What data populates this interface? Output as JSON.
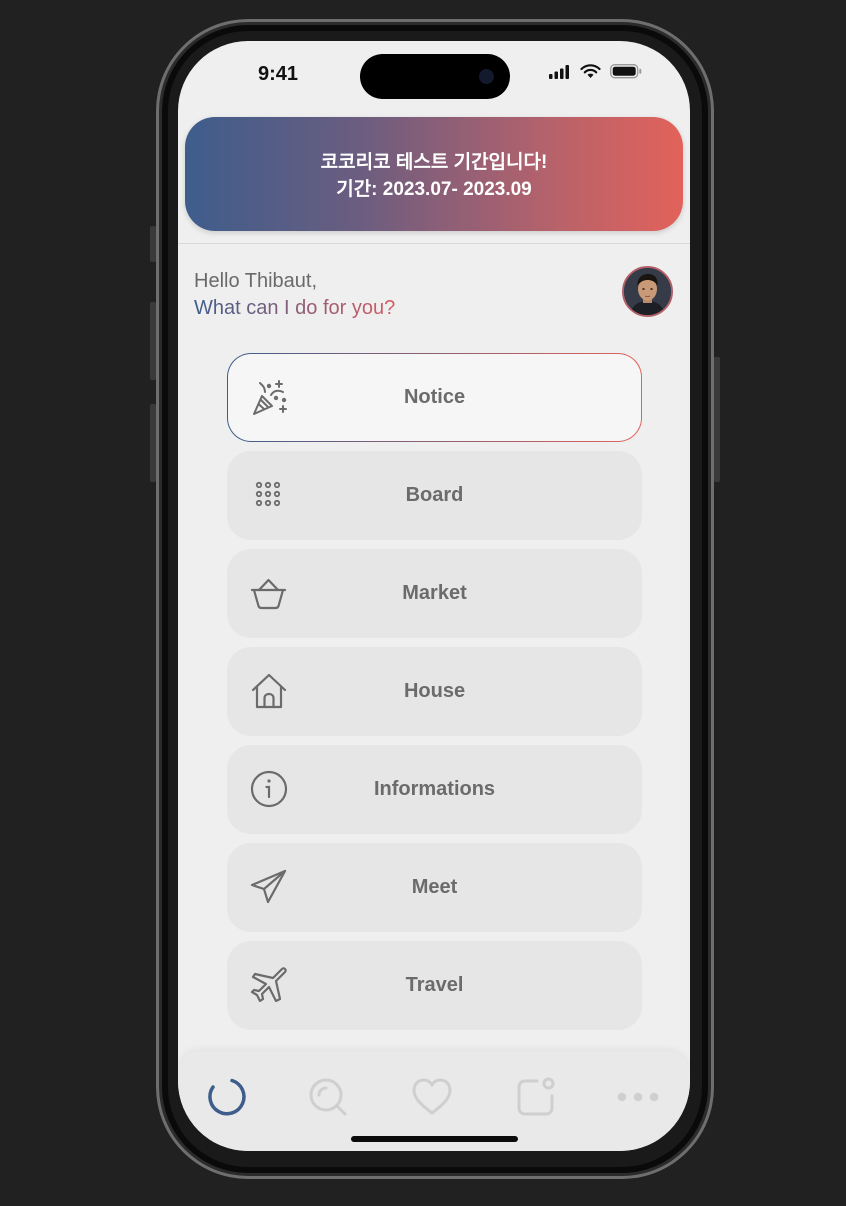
{
  "status_bar": {
    "time": "9:41"
  },
  "banner": {
    "title": "코코리코 테스트 기간입니다!",
    "period": "기간: 2023.07- 2023.09"
  },
  "greeting": {
    "hello": "Hello Thibaut,",
    "question": "What can I do for you?"
  },
  "menu": {
    "items": [
      {
        "label": "Notice",
        "icon": "party-popper-icon",
        "active": true
      },
      {
        "label": "Board",
        "icon": "grid-dots-icon"
      },
      {
        "label": "Market",
        "icon": "basket-icon"
      },
      {
        "label": "House",
        "icon": "house-icon"
      },
      {
        "label": "Informations",
        "icon": "info-icon"
      },
      {
        "label": "Meet",
        "icon": "paper-plane-icon"
      },
      {
        "label": "Travel",
        "icon": "airplane-icon"
      }
    ]
  },
  "tab_bar": {
    "tabs": [
      {
        "icon": "spinner-icon",
        "active": true
      },
      {
        "icon": "search-icon"
      },
      {
        "icon": "heart-icon"
      },
      {
        "icon": "notification-square-icon"
      },
      {
        "icon": "more-dots-icon"
      }
    ]
  },
  "colors": {
    "gradient_start": "#3e5d8c",
    "gradient_end": "#e2625a",
    "background": "#efefef",
    "menu_item_bg": "#e6e6e6",
    "text_gray": "#6b6b6b"
  }
}
